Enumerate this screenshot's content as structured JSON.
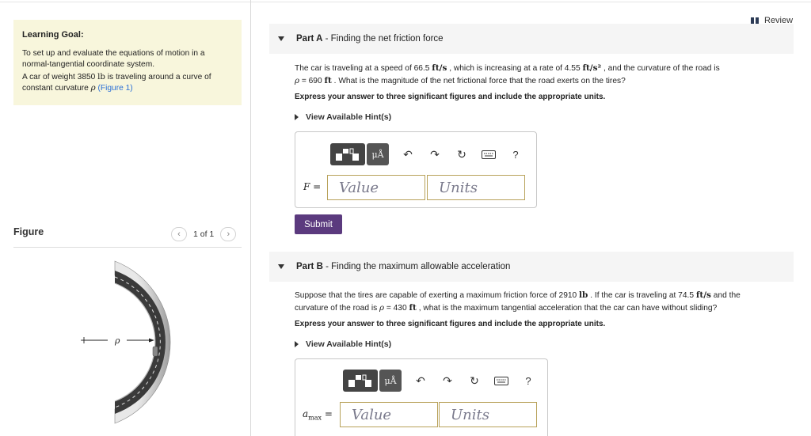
{
  "left": {
    "goal_title": "Learning Goal:",
    "goal_line1": "To set up and evaluate the equations of motion in a normal-tangential coordinate system.",
    "goal_line2_pre": "A car of weight 3850 ",
    "goal_line2_unit": "lb",
    "goal_line2_mid": " is traveling around a curve of constant curvature ",
    "goal_line2_rho": "ρ",
    "goal_line2_link": "(Figure 1)",
    "figure_label": "Figure",
    "figure_count": "1 of 1",
    "prev_icon": "chevron-left-icon",
    "next_icon": "chevron-right-icon",
    "figure_rho": "ρ"
  },
  "review": {
    "label": "Review",
    "icon": "review-icon"
  },
  "partA": {
    "prefix": "Part A",
    "title": " - Finding the net friction force",
    "q1_a": "The car is traveling at a speed of 66.5 ",
    "q1_unit1": "ft/s",
    "q1_b": " , which is increasing at a rate of 4.55 ",
    "q1_unit2": "ft/s²",
    "q1_c": " , and the curvature of the road is",
    "q2_rho": "ρ",
    "q2_a": " = 690 ",
    "q2_unit": "ft",
    "q2_b": " . What is the magnitude of the net frictional force that the road exerts on the tires?",
    "instruction": "Express your answer to three significant figures and include the appropriate units.",
    "hint": "View Available Hint(s)",
    "var_label": "F =",
    "value_placeholder": "Value",
    "units_placeholder": "Units",
    "submit": "Submit"
  },
  "partB": {
    "prefix": "Part B",
    "title": " - Finding the maximum allowable acceleration",
    "q1_a": "Suppose that the tires are capable of exerting a maximum friction force of 2910 ",
    "q1_unit1": "lb",
    "q1_b": " . If the car is traveling at 74.5 ",
    "q1_unit2": "ft/s",
    "q1_c": " and the",
    "q2_a": "curvature of the road is ",
    "q2_rho": "ρ",
    "q2_b": " = 430 ",
    "q2_unit": "ft",
    "q2_c": " , what is the maximum tangential acceleration that the car can have without sliding?",
    "instruction": "Express your answer to three significant figures and include the appropriate units.",
    "hint": "View Available Hint(s)",
    "var_label": "a",
    "var_sub": "max",
    "var_eq": " =",
    "value_placeholder": "Value",
    "units_placeholder": "Units"
  },
  "toolbar": {
    "mu_label": "μÅ",
    "undo_icon": "undo-icon",
    "redo_icon": "redo-icon",
    "reset_icon": "reset-icon",
    "keyboard_icon": "keyboard-icon",
    "help_label": "?"
  },
  "colors": {
    "goal_bg": "#f8f6dc",
    "submit_bg": "#5b3a7e",
    "link": "#2a6fd6",
    "field_border": "#b8a25a"
  }
}
